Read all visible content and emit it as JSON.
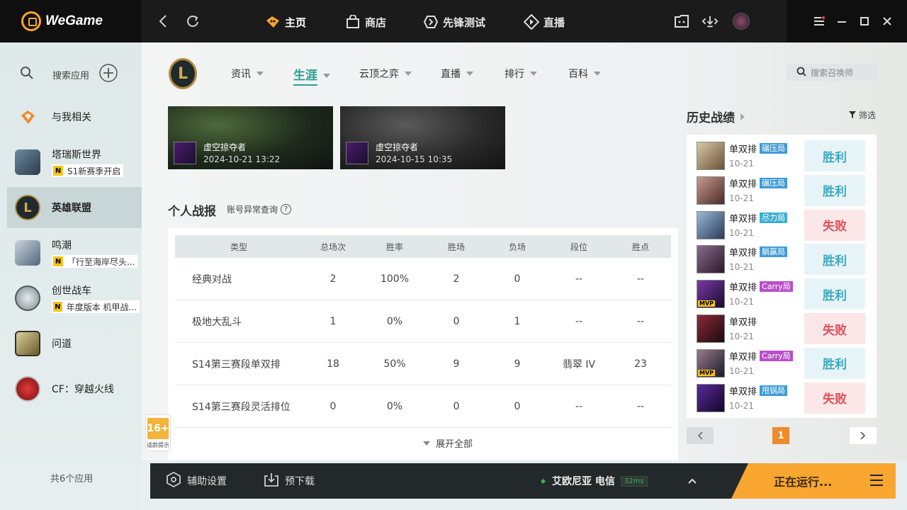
{
  "app": {
    "name": "WeGame"
  },
  "topnav": [
    {
      "label": "主页",
      "icon": "home-icon"
    },
    {
      "label": "商店",
      "icon": "shop-icon"
    },
    {
      "label": "先锋测试",
      "icon": "vanguard-icon"
    },
    {
      "label": "直播",
      "icon": "live-icon"
    }
  ],
  "sidebar": {
    "search_label": "搜索应用",
    "items": [
      {
        "name": "与我相关",
        "sub": ""
      },
      {
        "name": "塔瑞斯世界",
        "sub": "S1新赛季开启"
      },
      {
        "name": "英雄联盟",
        "sub": ""
      },
      {
        "name": "鸣潮",
        "sub": "「行至海岸尽头..."
      },
      {
        "name": "创世战车",
        "sub": "年度版本 机甲战..."
      },
      {
        "name": "问道",
        "sub": ""
      },
      {
        "name": "CF：穿越火线",
        "sub": ""
      }
    ],
    "count": "共6个应用"
  },
  "game_tabs": [
    {
      "label": "资讯"
    },
    {
      "label": "生涯"
    },
    {
      "label": "云顶之弈"
    },
    {
      "label": "直播"
    },
    {
      "label": "排行"
    },
    {
      "label": "百科"
    }
  ],
  "summoner_search": {
    "placeholder": "搜索召唤师"
  },
  "videos": [
    {
      "champion": "虚空掠夺者",
      "time": "2024-10-21 13:22"
    },
    {
      "champion": "虚空掠夺者",
      "time": "2024-10-15 10:35"
    }
  ],
  "report": {
    "title": "个人战报",
    "anomaly_link": "账号异常查询",
    "columns": [
      "类型",
      "总场次",
      "胜率",
      "胜场",
      "负场",
      "段位",
      "胜点"
    ],
    "rows": [
      [
        "经典对战",
        "2",
        "100%",
        "2",
        "0",
        "--",
        "--"
      ],
      [
        "极地大乱斗",
        "1",
        "0%",
        "0",
        "1",
        "--",
        "--"
      ],
      [
        "S14第三赛段单双排",
        "18",
        "50%",
        "9",
        "9",
        "翡翠 IV",
        "23"
      ],
      [
        "S14第三赛段灵活排位",
        "0",
        "0%",
        "0",
        "0",
        "--",
        "--"
      ]
    ],
    "expand": "展开全部"
  },
  "age_rating": {
    "label": "16+",
    "note": "适龄提示"
  },
  "history": {
    "title": "历史战绩",
    "filter": "筛选",
    "matches": [
      {
        "queue": "单双排",
        "tag": "碾压局",
        "date": "10-21",
        "result": "胜利",
        "win": true,
        "mvp": false,
        "tag_color": "#3d9bd8"
      },
      {
        "queue": "单双排",
        "tag": "碾压局",
        "date": "10-21",
        "result": "胜利",
        "win": true,
        "mvp": false,
        "tag_color": "#3d9bd8"
      },
      {
        "queue": "单双排",
        "tag": "尽力局",
        "date": "10-21",
        "result": "失败",
        "win": false,
        "mvp": false,
        "tag_color": "#3ab0d0"
      },
      {
        "queue": "单双排",
        "tag": "躺赢局",
        "date": "10-21",
        "result": "胜利",
        "win": true,
        "mvp": false,
        "tag_color": "#3d9bd8"
      },
      {
        "queue": "单双排",
        "tag": "Carry局",
        "date": "10-21",
        "result": "胜利",
        "win": true,
        "mvp": true,
        "tag_color": "#b84fc8"
      },
      {
        "queue": "单双排",
        "tag": "",
        "date": "10-21",
        "result": "失败",
        "win": false,
        "mvp": false,
        "tag_color": ""
      },
      {
        "queue": "单双排",
        "tag": "Carry局",
        "date": "10-21",
        "result": "胜利",
        "win": true,
        "mvp": true,
        "tag_color": "#b84fc8"
      },
      {
        "queue": "单双排",
        "tag": "甩锅局",
        "date": "10-21",
        "result": "失败",
        "win": false,
        "mvp": false,
        "tag_color": "#3d9bd8"
      }
    ],
    "page": "1"
  },
  "bottombar": {
    "assist": "辅助设置",
    "download": "预下载",
    "server": "艾欧尼亚 电信",
    "ping": "32ms",
    "running": "正在运行..."
  }
}
